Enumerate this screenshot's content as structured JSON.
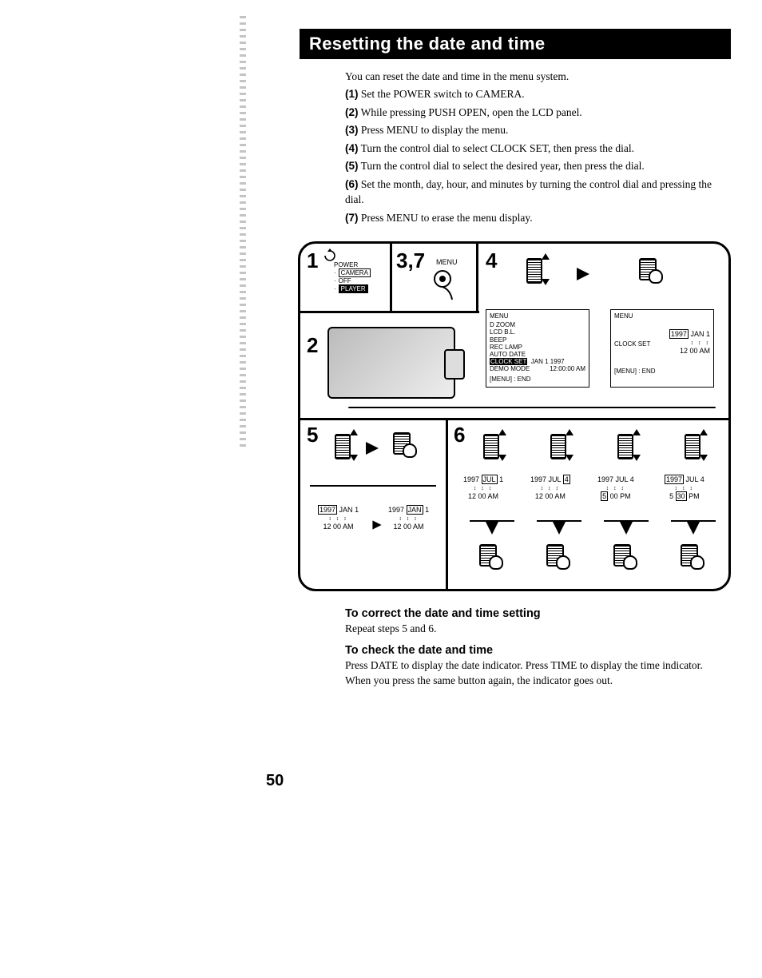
{
  "title": "Resetting the date and time",
  "intro": "You can reset the date and time in the menu system.",
  "steps": [
    {
      "num": "(1)",
      "text": "Set the POWER switch to CAMERA."
    },
    {
      "num": "(2)",
      "text": "While pressing PUSH OPEN, open the LCD panel."
    },
    {
      "num": "(3)",
      "text": "Press MENU to display the menu."
    },
    {
      "num": "(4)",
      "text": "Turn the control dial to select CLOCK SET, then press the dial."
    },
    {
      "num": "(5)",
      "text": "Turn the control dial to select the desired year, then press the dial."
    },
    {
      "num": "(6)",
      "text": "Set the month, day, hour, and minutes by turning the control dial and pressing the dial.",
      "wrap": true
    },
    {
      "num": "(7)",
      "text": "Press MENU to erase the menu display."
    }
  ],
  "panels": {
    "p1": "1",
    "p2": "2",
    "p37": "3,7",
    "p4": "4",
    "p5": "5",
    "p6": "6"
  },
  "labels": {
    "menu": "MENU",
    "power": "POWER",
    "camera": "CAMERA",
    "off": "OFF",
    "player": "PLAYER"
  },
  "screen4a": {
    "hdr": "MENU",
    "items": [
      "D ZOOM",
      "LCD B.L.",
      "BEEP",
      "REC LAMP",
      "AUTO DATE",
      "CLOCK SET",
      "DEMO MODE"
    ],
    "side1": "JAN  1 1997",
    "side2": "12:00:00 AM",
    "foot": "[MENU] : END"
  },
  "screen4b": {
    "hdr": "MENU",
    "main": "CLOCK SET",
    "date": "1997 JAN  1",
    "time": "12 00 AM",
    "foot": "[MENU] : END"
  },
  "dt5a": {
    "y": "1997",
    "m": "JAN",
    "d": "1",
    "t": "12 00 AM"
  },
  "dt5b": {
    "y": "1997",
    "m": "JAN",
    "d": "1",
    "t": "12 00 AM"
  },
  "dt6a": {
    "y": "1997",
    "m": "JUL",
    "d": "1",
    "t": "12 00 AM"
  },
  "dt6b": {
    "y": "1997",
    "m": "JUL",
    "d": "4",
    "t": "12 00 AM"
  },
  "dt6c": {
    "y": "1997",
    "m": "JUL",
    "d": "4",
    "t": "5 00 PM"
  },
  "dt6d": {
    "y": "1997",
    "m": "JUL",
    "d": "4",
    "t": "5 30 PM"
  },
  "sec1": {
    "h": "To correct the date and time setting",
    "p": "Repeat steps 5 and 6."
  },
  "sec2": {
    "h": "To check the date and time",
    "p": "Press DATE to display the date indicator. Press TIME to display the time indicator. When you press the same button again, the indicator goes out."
  },
  "page": "50"
}
